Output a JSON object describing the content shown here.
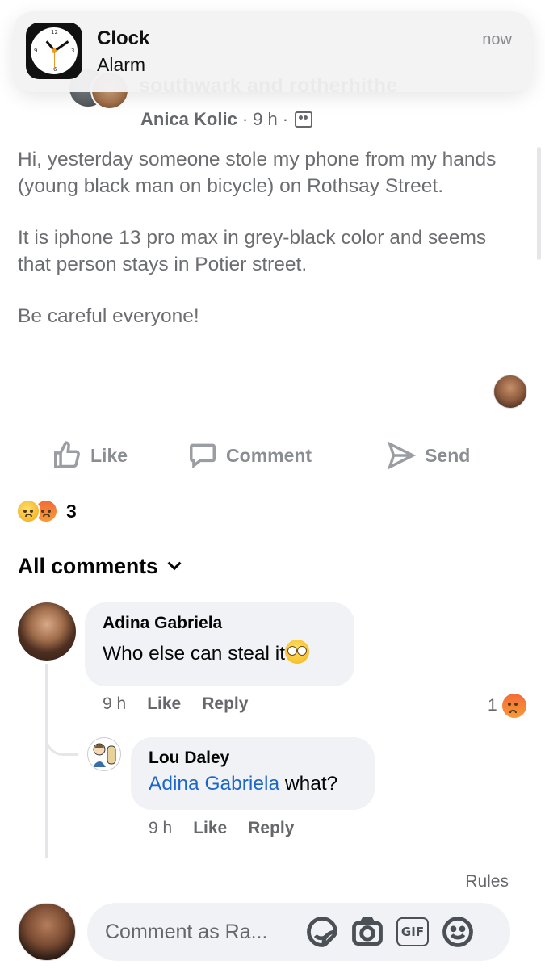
{
  "notification": {
    "app": "Clock",
    "message": "Alarm",
    "time": "now",
    "icon": "clock-app-icon"
  },
  "post": {
    "group_name_partial": "southwark and rotherhithe",
    "author": "Anica Kolic",
    "time": "9 h",
    "separator": "·",
    "paragraphs": [
      "Hi, yesterday someone stole my phone from my hands (young black man on bicycle) on Rothsay Street.",
      "It is iphone 13 pro max in grey-black color and seems that person stays in Potier street.",
      "Be careful everyone!"
    ]
  },
  "actions": {
    "like": "Like",
    "comment": "Comment",
    "send": "Send"
  },
  "reactions": {
    "types": [
      "sad",
      "angry"
    ],
    "count": "3"
  },
  "comments_header": "All comments",
  "comments": [
    {
      "name": "Adina Gabriela",
      "text": "Who else can steal it",
      "emoji": "face-with-rolling-eyes",
      "time": "9 h",
      "like": "Like",
      "reply": "Reply",
      "reaction_count": "1",
      "reaction_type": "angry"
    },
    {
      "name": "Lou Daley",
      "mention": "Adina Gabriela",
      "text": " what?",
      "time": "9 h",
      "like": "Like",
      "reply": "Reply"
    }
  ],
  "composer": {
    "rules": "Rules",
    "placeholder": "Comment as Ra...",
    "icons": [
      "sticker-icon",
      "camera-icon",
      "gif-icon",
      "emoji-icon"
    ],
    "gif_label": "GIF"
  },
  "colors": {
    "accent_link": "#1b66c9",
    "muted_text": "#65676b",
    "bubble_bg": "#f0f2f5"
  }
}
